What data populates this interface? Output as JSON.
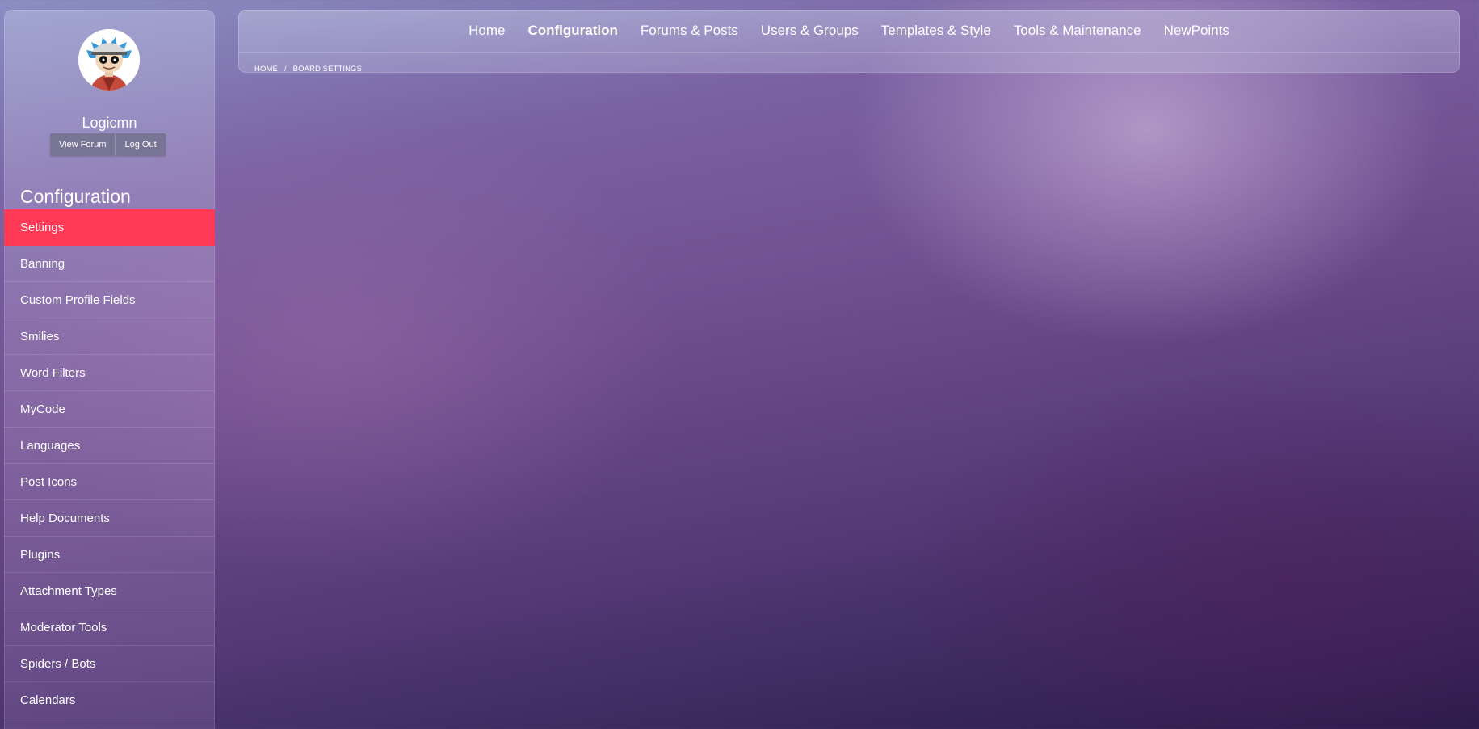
{
  "user": {
    "name": "Logicmn",
    "actions": [
      "View Forum",
      "Log Out"
    ]
  },
  "sidebar": {
    "section_title": "Configuration",
    "items": [
      {
        "label": "Settings",
        "active": true
      },
      {
        "label": "Banning"
      },
      {
        "label": "Custom Profile Fields"
      },
      {
        "label": "Smilies"
      },
      {
        "label": "Word Filters"
      },
      {
        "label": "MyCode"
      },
      {
        "label": "Languages"
      },
      {
        "label": "Post Icons"
      },
      {
        "label": "Help Documents"
      },
      {
        "label": "Plugins"
      },
      {
        "label": "Attachment Types"
      },
      {
        "label": "Moderator Tools"
      },
      {
        "label": "Spiders / Bots"
      },
      {
        "label": "Calendars"
      }
    ]
  },
  "nav": {
    "items": [
      {
        "label": "Home"
      },
      {
        "label": "Configuration",
        "current": true
      },
      {
        "label": "Forums & Posts"
      },
      {
        "label": "Users & Groups"
      },
      {
        "label": "Templates & Style"
      },
      {
        "label": "Tools & Maintenance"
      },
      {
        "label": "NewPoints"
      }
    ]
  },
  "breadcrumb": {
    "items": [
      "Home",
      "Board Settings"
    ],
    "separator": "/"
  },
  "colors": {
    "active_item": "#ff3a57",
    "text": "#ffffff"
  }
}
